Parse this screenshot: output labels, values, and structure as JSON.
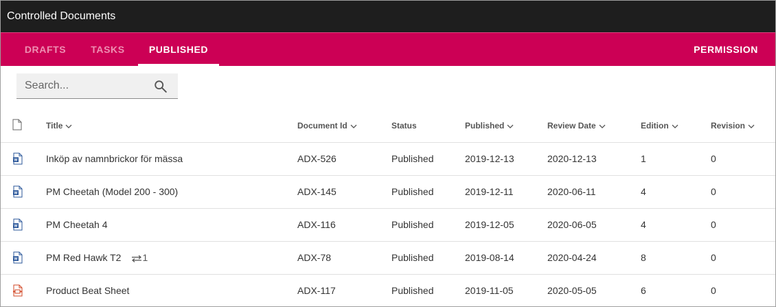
{
  "app": {
    "title": "Controlled Documents"
  },
  "tabs": [
    {
      "label": "DRAFTS",
      "active": false
    },
    {
      "label": "TASKS",
      "active": false
    },
    {
      "label": "PUBLISHED",
      "active": true
    }
  ],
  "permission_label": "PERMISSION",
  "search": {
    "placeholder": "Search...",
    "value": ""
  },
  "table": {
    "columns": [
      "Title",
      "Document Id",
      "Status",
      "Published",
      "Review Date",
      "Edition",
      "Revision"
    ],
    "rows": [
      {
        "icon": "word-document-icon",
        "title": "Inköp av namnbrickor för mässa",
        "doc_id": "ADX-526",
        "status": "Published",
        "published": "2019-12-13",
        "review": "2020-12-13",
        "edition": "1",
        "revision": "0"
      },
      {
        "icon": "word-document-icon",
        "title": "PM Cheetah (Model 200 - 300)",
        "doc_id": "ADX-145",
        "status": "Published",
        "published": "2019-12-11",
        "review": "2020-06-11",
        "edition": "4",
        "revision": "0"
      },
      {
        "icon": "word-document-icon",
        "title": "PM Cheetah 4",
        "doc_id": "ADX-116",
        "status": "Published",
        "published": "2019-12-05",
        "review": "2020-06-05",
        "edition": "4",
        "revision": "0"
      },
      {
        "icon": "word-document-icon",
        "title": "PM Red Hawk T2",
        "link_count": "1",
        "doc_id": "ADX-78",
        "status": "Published",
        "published": "2019-08-14",
        "review": "2020-04-24",
        "edition": "8",
        "revision": "0"
      },
      {
        "icon": "pdf-document-icon",
        "title": "Product Beat Sheet",
        "doc_id": "ADX-117",
        "status": "Published",
        "published": "2019-11-05",
        "review": "2020-05-05",
        "edition": "6",
        "revision": "0"
      }
    ]
  },
  "colors": {
    "titlebar": "#1e1e1e",
    "accent": "#cc0055",
    "word_blue": "#2b579a",
    "pdf_red": "#d24726"
  }
}
